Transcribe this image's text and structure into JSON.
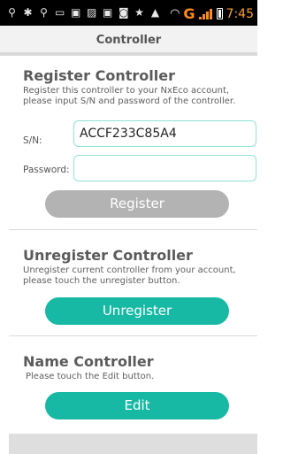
{
  "status_bar": {
    "left_icons": [
      "usb-icon",
      "debug-icon",
      "usb-icon",
      "sd-card-icon",
      "app-icon",
      "image-icon",
      "app-icon",
      "app-icon",
      "star-icon",
      "warning-icon"
    ],
    "network_label": "G",
    "time": "7:45"
  },
  "header": {
    "title": "Controller"
  },
  "register": {
    "title": "Register Controller",
    "description": "Register this controller to your NxEco account, please input S/N and password of the controller.",
    "sn_label": "S/N:",
    "sn_value": "ACCF233C85A4",
    "password_label": "Password:",
    "password_value": "",
    "button_label": "Register",
    "button_color": "#b3b3b3"
  },
  "unregister": {
    "title": "Unregister Controller",
    "description": "Unregister current controller from your account, please touch the unregister button.",
    "button_label": "Unregister",
    "button_color": "#17b9a4"
  },
  "name": {
    "title": "Name Controller",
    "description": "Please touch the Edit button.",
    "button_label": "Edit",
    "button_color": "#17b9a4"
  }
}
